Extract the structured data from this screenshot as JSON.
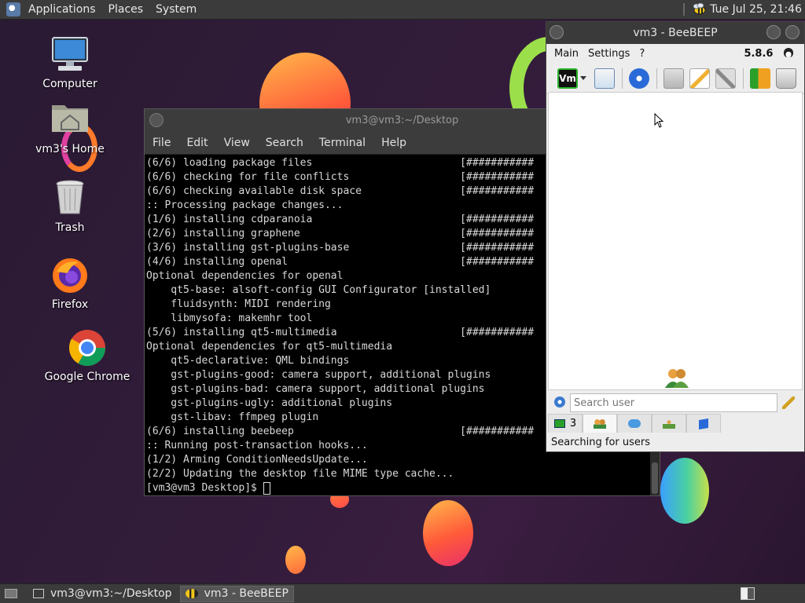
{
  "top_panel": {
    "menus": [
      "Applications",
      "Places",
      "System"
    ],
    "clock": "Tue Jul 25, 21:46"
  },
  "desktop_icons": [
    {
      "label": "Computer",
      "icon": "computer-icon"
    },
    {
      "label": "vm3's Home",
      "icon": "home-folder-icon"
    },
    {
      "label": "Trash",
      "icon": "trash-icon"
    },
    {
      "label": "Firefox",
      "icon": "firefox-icon"
    },
    {
      "label": "Google Chrome",
      "icon": "chrome-icon"
    }
  ],
  "terminal": {
    "title": "vm3@vm3:~/Desktop",
    "menus": [
      "File",
      "Edit",
      "View",
      "Search",
      "Terminal",
      "Help"
    ],
    "lines": [
      "(6/6) loading package files                        [###########",
      "(6/6) checking for file conflicts                  [###########",
      "(6/6) checking available disk space                [###########",
      ":: Processing package changes...",
      "(1/6) installing cdparanoia                        [###########",
      "(2/6) installing graphene                          [###########",
      "(3/6) installing gst-plugins-base                  [###########",
      "(4/6) installing openal                            [###########",
      "Optional dependencies for openal",
      "    qt5-base: alsoft-config GUI Configurator [installed]",
      "    fluidsynth: MIDI rendering",
      "    libmysofa: makemhr tool",
      "(5/6) installing qt5-multimedia                    [###########",
      "Optional dependencies for qt5-multimedia",
      "    qt5-declarative: QML bindings",
      "    gst-plugins-good: camera support, additional plugins",
      "    gst-plugins-bad: camera support, additional plugins",
      "    gst-plugins-ugly: additional plugins",
      "    gst-libav: ffmpeg plugin",
      "(6/6) installing beebeep                           [###########",
      ":: Running post-transaction hooks...",
      "(1/2) Arming ConditionNeedsUpdate...",
      "(2/2) Updating the desktop file MIME type cache..."
    ],
    "prompt": "[vm3@vm3 Desktop]$ "
  },
  "beebeep": {
    "title": "vm3 - BeeBEEP",
    "menus": [
      "Main",
      "Settings",
      "?"
    ],
    "version": "5.8.6",
    "search_placeholder": "Search user",
    "tab_count": "3",
    "status": "Searching for users"
  },
  "taskbar": {
    "tasks": [
      "vm3@vm3:~/Desktop",
      "vm3 - BeeBEEP"
    ]
  }
}
